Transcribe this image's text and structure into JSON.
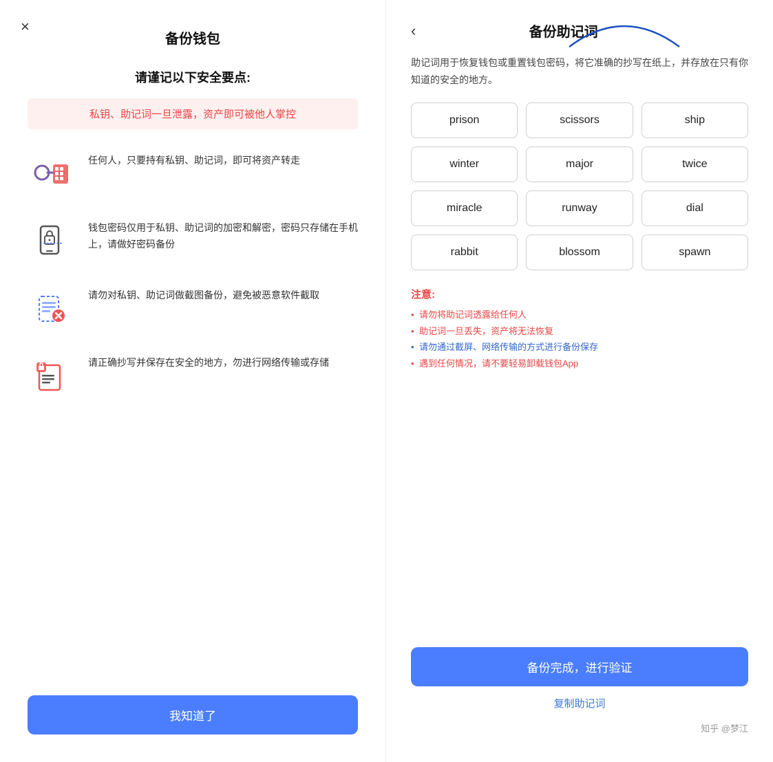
{
  "left": {
    "close_icon": "×",
    "title": "备份钱包",
    "security_heading": "请谨记以下安全要点:",
    "warning_text": "私钥、助记词一旦泄露，资产即可被他人掌控",
    "items": [
      {
        "icon": "keys",
        "text": "任何人，只要持有私钥、助记词，即可将资产转走"
      },
      {
        "icon": "phone-lock",
        "text": "钱包密码仅用于私钥、助记词的加密和解密，密码只存储在手机上，请做好密码备份"
      },
      {
        "icon": "screenshot",
        "text": "请勿对私钥、助记词做截图备份，避免被恶意软件截取"
      },
      {
        "icon": "save",
        "text": "请正确抄写并保存在安全的地方，勿进行网络传输或存储"
      }
    ],
    "button_label": "我知道了"
  },
  "right": {
    "back_icon": "‹",
    "title": "备份助记词",
    "desc": "助记词用于恢复钱包或重置钱包密码，将它准确的抄写在纸上，并存放在只有你知道的安全的地方。",
    "mnemonic": [
      "prison",
      "scissors",
      "ship",
      "winter",
      "major",
      "twice",
      "miracle",
      "runway",
      "dial",
      "rabbit",
      "blossom",
      "spawn"
    ],
    "notes_title": "注意:",
    "notes": [
      {
        "text": "请勿将助记词透露给任何人",
        "color": "red"
      },
      {
        "text": "助记词一旦丢失，资产将无法恢复",
        "color": "red"
      },
      {
        "text": "请勿通过截屏、网络传输的方式进行备份保存",
        "color": "blue"
      },
      {
        "text": "遇到任何情况，请不要轻易卸载钱包App",
        "color": "red"
      }
    ],
    "button_label": "备份完成，进行验证",
    "copy_label": "复制助记词",
    "watermark": "知乎 @梦江"
  }
}
